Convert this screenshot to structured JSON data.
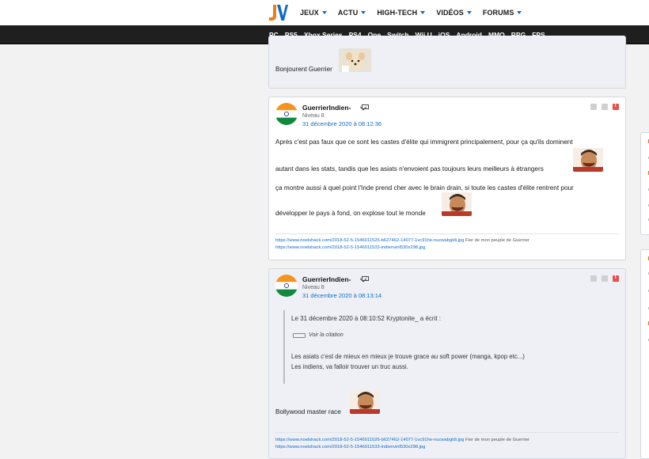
{
  "nav": {
    "logo_text": "JV",
    "menu": [
      "JEUX",
      "ACTU",
      "HIGH-TECH",
      "VIDÉOS",
      "FORUMS"
    ],
    "platforms": [
      "PC",
      "PS5",
      "Xbox Series",
      "PS4",
      "One",
      "Switch",
      "Wii U",
      "iOS",
      "Android",
      "MMO",
      "RPG",
      "FPS"
    ]
  },
  "posts": [
    {
      "text": "Bonjourent Guerrier"
    },
    {
      "author": "GuerrierIndien-",
      "level": "Niveau 8",
      "date": "31 décembre 2020 à 08:12:36",
      "lines": [
        "Après c'est pas faux que ce sont les castes d'élite qui immigrent principalement, pour ça qu'ils dominent",
        "autant dans les stats, tandis que les asiats n'envoient pas toujours leurs meilleurs à étrangers",
        "ça montre aussi à quel point l'Inde prend cher avec le brain drain, si toute les castes d'élite rentrent pour",
        "développer le pays à fond, on explose tout le monde"
      ],
      "signature": {
        "link1": "https://www.noelshack.com/2018-52-5-1546011526-b627462-14077-1vc91he-nucwabgldi.jpg",
        "link1_note": " Fier de mon peuple de Guerrier",
        "link2": "https://www.noelshack.com/2018-52-5-1546011533-indienviril530x298.jpg"
      }
    },
    {
      "author": "GuerrierIndien-",
      "level": "Niveau 8",
      "date": "31 décembre 2020 à 08:13:14",
      "quote": {
        "header": "Le 31 décembre 2020 à 08:10:52 Kryptonite_ a écrit :",
        "voir": "Voir la citation",
        "line1": "Les asiats c'est de mieux en mieux je trouve grace au soft power (manga, kpop etc...)",
        "line2": "Les indiens, va falloir trouver un truc aussi."
      },
      "text": "Bollywood master race",
      "signature": {
        "link1": "https://www.noelshack.com/2018-52-5-1546011526-b627462-14077-1vc91he-nucwabgldi.jpg",
        "link1_note": " Fier de mon peuple de Guerrier",
        "link2": "https://www.noelshack.com/2018-52-5-1546011533-indienviril530x298.jpg"
      }
    }
  ],
  "colors": {
    "brand_blue": "#0e6bc9",
    "logo_orange": "#f27c14",
    "platform_bar": "#1f1f1f",
    "post_bg_alt": "#eef0f5"
  }
}
